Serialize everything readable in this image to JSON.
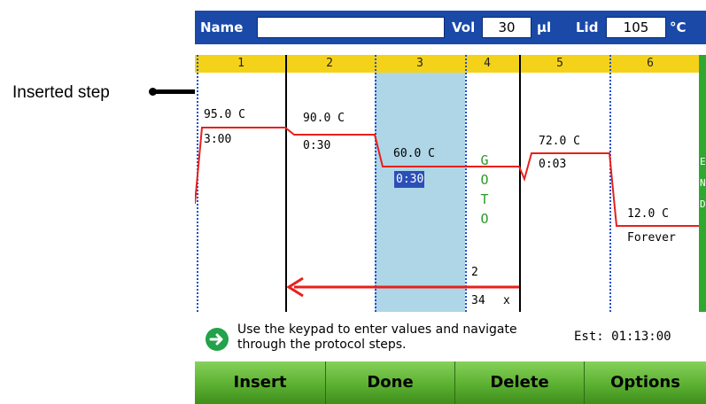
{
  "callout": {
    "label": "Inserted step"
  },
  "topbar": {
    "name_label": "Name",
    "name_value": "",
    "vol_label": "Vol",
    "vol_value": "30",
    "vol_unit": "µl",
    "lid_label": "Lid",
    "lid_value": "105",
    "lid_unit": "°C"
  },
  "steps": [
    {
      "num": "1",
      "temp": "95.0 C",
      "time": "3:00"
    },
    {
      "num": "2",
      "temp": "90.0 C",
      "time": "0:30"
    },
    {
      "num": "3",
      "temp": "60.0 C",
      "time": "0:30"
    },
    {
      "num": "4",
      "goto_letters": [
        "G",
        "O",
        "T",
        "O"
      ],
      "goto_step": "2",
      "goto_count": "34",
      "goto_x": "x"
    },
    {
      "num": "5",
      "temp": "72.0 C",
      "time": "0:03"
    },
    {
      "num": "6",
      "temp": "12.0 C",
      "time": "Forever"
    }
  ],
  "end_letters": [
    "E",
    "N",
    "D"
  ],
  "hint": "Use the keypad to enter values and navigate through the protocol steps.",
  "estimate": "Est:  01:13:00",
  "buttons": {
    "insert": "Insert",
    "done": "Done",
    "delete": "Delete",
    "options": "Options"
  },
  "colors": {
    "topbar": "#1a49a8",
    "step_header": "#f5d21a",
    "inserted_highlight": "#aed6e6",
    "curve": "#e8201c",
    "goto": "#2a9a2a",
    "button": "#5bb031"
  },
  "icons": {
    "hint": "arrow-right-circle-icon"
  }
}
